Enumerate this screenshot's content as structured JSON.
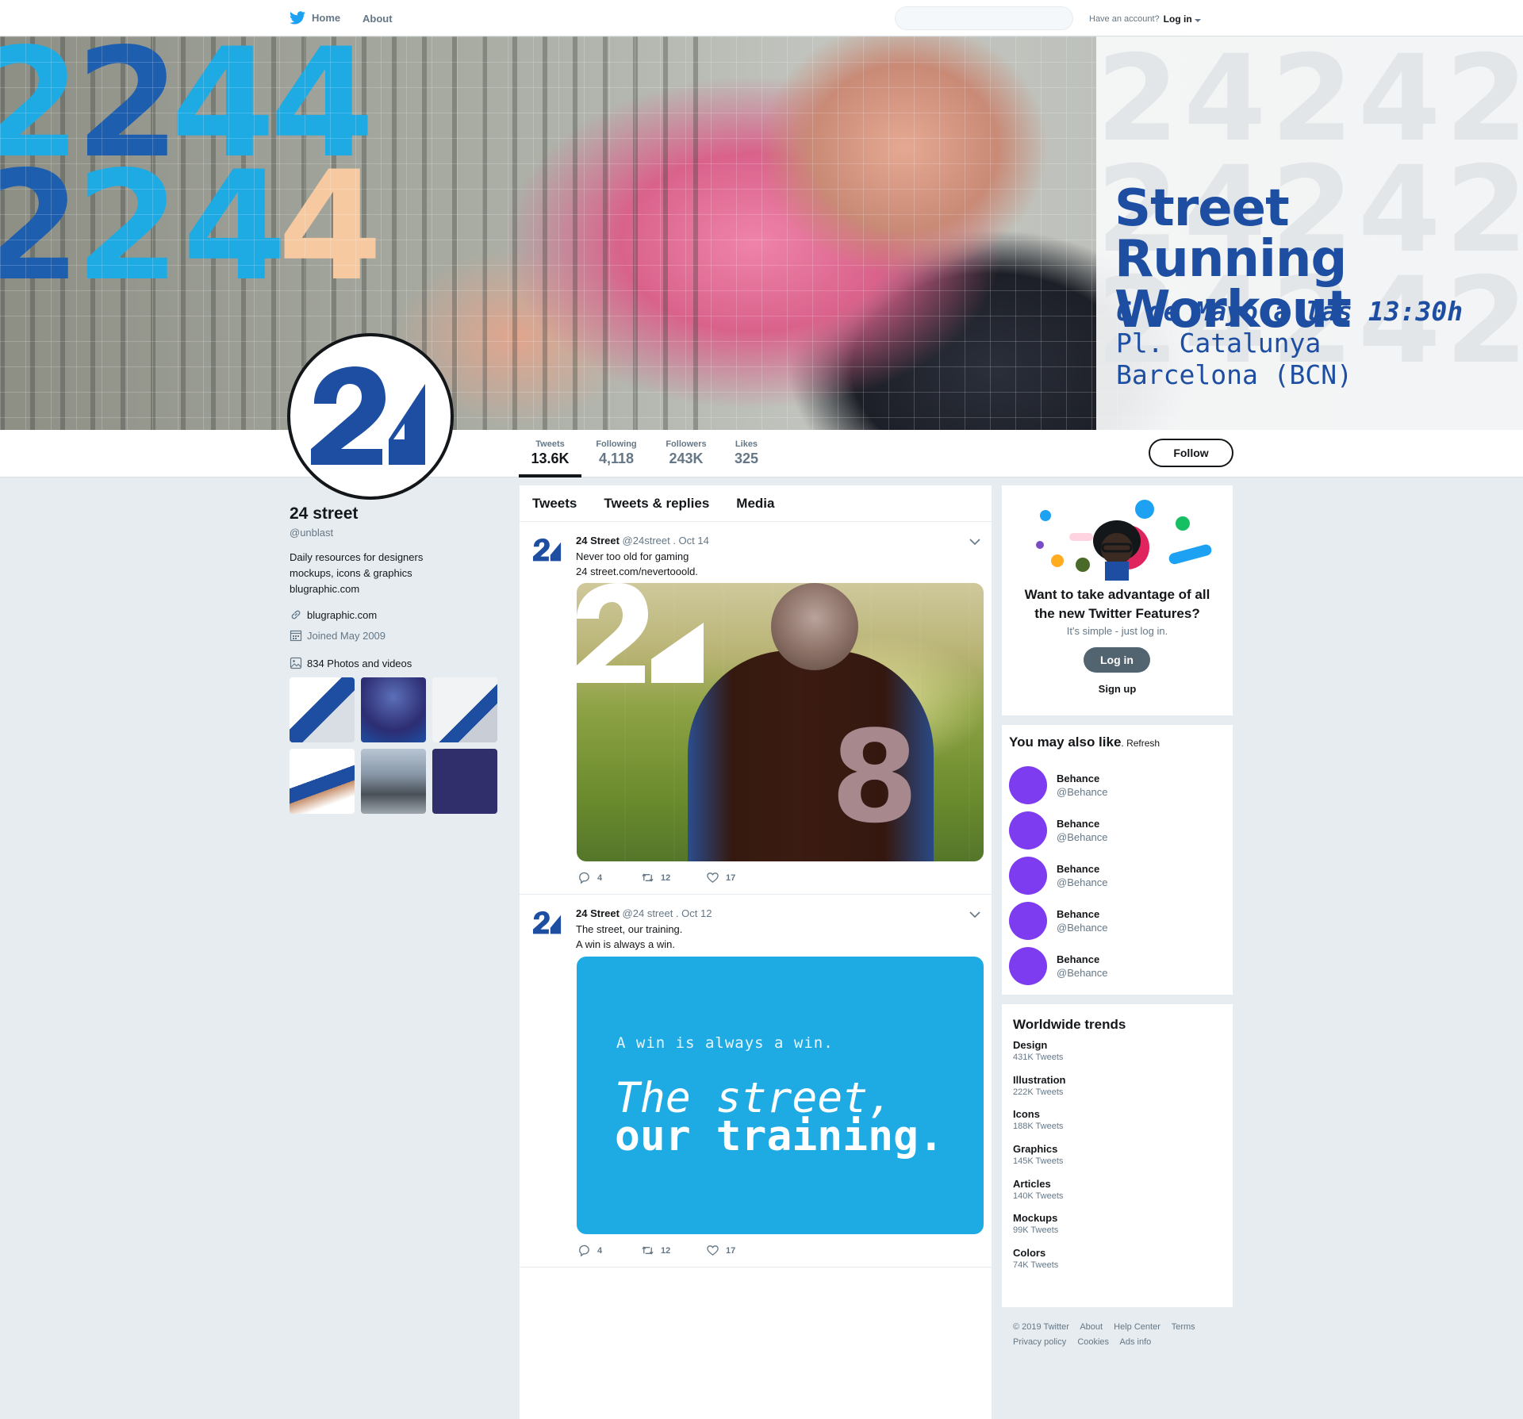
{
  "nav": {
    "home": "Home",
    "about": "About",
    "account_prompt": "Have an account?",
    "login": "Log in"
  },
  "banner": {
    "title_line1": "Street Running",
    "title_line2": "Workout",
    "date": "6 de Mayo a las 13:30h",
    "place_line1": "Pl. Catalunya",
    "place_line2": "Barcelona (BCN)",
    "colors": {
      "accent": "#1d4ea2",
      "light_blue": "#1eaae3",
      "peach": "#f7c9a0"
    }
  },
  "stats": [
    {
      "label": "Tweets",
      "value": "13.6K"
    },
    {
      "label": "Following",
      "value": "4,118"
    },
    {
      "label": "Followers",
      "value": "243K"
    },
    {
      "label": "Likes",
      "value": "325"
    }
  ],
  "follow_label": "Follow",
  "profile": {
    "name": "24 street",
    "handle": "@unblast",
    "bio_line1": "Daily resources for designers",
    "bio_line2": "mockups, icons & graphics",
    "bio_line3": "blugraphic.com",
    "website": "blugraphic.com",
    "joined": "Joined May 2009",
    "photos": "834 Photos and videos"
  },
  "tabs": [
    "Tweets",
    "Tweets & replies",
    "Media"
  ],
  "tweets": [
    {
      "name": "24 Street",
      "handle_date": "@24street . Oct 14",
      "line1": "Never too old for gaming",
      "line2": "24 street.com/nevertooold.",
      "replies": "4",
      "retweets": "12",
      "likes": "17",
      "media_number": "8"
    },
    {
      "name": "24 Street",
      "handle_date": "@24 street . Oct 12",
      "line1": "The street, our training.",
      "line2": "A win is always a win.",
      "replies": "4",
      "retweets": "12",
      "likes": "17",
      "card_small": "A win is always a win.",
      "card_big1": "The street,",
      "card_big2": "our training."
    }
  ],
  "promo": {
    "title_line1": "Want to take advantage of all",
    "title_line2": "the new Twitter Features?",
    "subtitle": "It's simple - just log in.",
    "login": "Log in",
    "signup": "Sign up"
  },
  "who_to_follow": {
    "title": "You may also like",
    "refresh": ". Refresh",
    "items": [
      {
        "name": "Behance",
        "handle": "@Behance"
      },
      {
        "name": "Behance",
        "handle": "@Behance"
      },
      {
        "name": "Behance",
        "handle": "@Behance"
      },
      {
        "name": "Behance",
        "handle": "@Behance"
      },
      {
        "name": "Behance",
        "handle": "@Behance"
      }
    ]
  },
  "trends": {
    "title": "Worldwide trends",
    "items": [
      {
        "name": "Design",
        "count": "431K Tweets"
      },
      {
        "name": "Illustration",
        "count": "222K Tweets"
      },
      {
        "name": "Icons",
        "count": "188K Tweets"
      },
      {
        "name": "Graphics",
        "count": "145K Tweets"
      },
      {
        "name": "Articles",
        "count": "140K Tweets"
      },
      {
        "name": "Mockups",
        "count": "99K Tweets"
      },
      {
        "name": "Colors",
        "count": "74K Tweets"
      }
    ]
  },
  "footer": {
    "links_row1": [
      "© 2019 Twitter",
      "About",
      "Help Center",
      "Terms"
    ],
    "links_row2": [
      "Privacy policy",
      "Cookies",
      "Ads info"
    ]
  }
}
